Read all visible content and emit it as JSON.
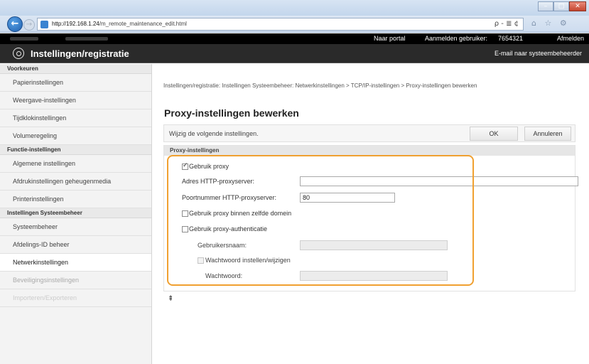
{
  "browser": {
    "url_host": "http://192.168.1.24",
    "url_path": "/m_remote_maintenance_edit.html",
    "addr_tools": "ρ - ≣ ¢",
    "nav_icons": "⌂ ☆ ⚙"
  },
  "topbar": {
    "portal_link": "Naar portal",
    "login_label": "Aanmelden gebruiker:",
    "user_id": "7654321",
    "logout_link": "Afmelden"
  },
  "appbar": {
    "title": "Instellingen/registratie",
    "mail_link": "E-mail naar systeembeheerder"
  },
  "sidebar": {
    "sections": [
      {
        "heading": "Voorkeuren",
        "items": [
          "Papierinstellingen",
          "Weergave-instellingen",
          "Tijdklokinstellingen",
          "Volumeregeling"
        ]
      },
      {
        "heading": "Functie-instellingen",
        "items": [
          "Algemene instellingen",
          "Afdrukinstellingen geheugenmedia",
          "Printerinstellingen"
        ]
      },
      {
        "heading": "Instellingen Systeembeheer",
        "items": [
          "Systeembeheer",
          "Afdelings-ID beheer",
          "Netwerkinstellingen",
          "Beveiligingsinstellingen",
          "Importeren/Exporteren"
        ]
      }
    ]
  },
  "main": {
    "breadcrumb": "Instellingen/registratie: Instellingen Systeembeheer: Netwerkinstellingen > TCP/IP-instellingen > Proxy-instellingen bewerken",
    "page_title": "Proxy-instellingen bewerken",
    "instruction": "Wijzig de volgende instellingen.",
    "ok_label": "OK",
    "cancel_label": "Annuleren",
    "section_heading": "Proxy-instellingen",
    "use_proxy_label": "Gebruik proxy",
    "use_proxy_checked": true,
    "http_address_label": "Adres HTTP-proxyserver:",
    "http_address_value": "",
    "port_label": "Poortnummer HTTP-proxyserver:",
    "port_value": "80",
    "same_domain_label": "Gebruik proxy binnen zelfde domein",
    "same_domain_checked": false,
    "auth_label": "Gebruik proxy-authenticatie",
    "auth_checked": false,
    "username_label": "Gebruikersnaam:",
    "username_value": "",
    "set_password_label": "Wachtwoord instellen/wijzigen",
    "set_password_checked": false,
    "password_label": "Wachtwoord:",
    "password_value": "",
    "top_icon": "⇞"
  },
  "colors": {
    "highlight": "#f0a030",
    "header_bg": "#2a2a2a",
    "topbar_bg": "#000000"
  }
}
